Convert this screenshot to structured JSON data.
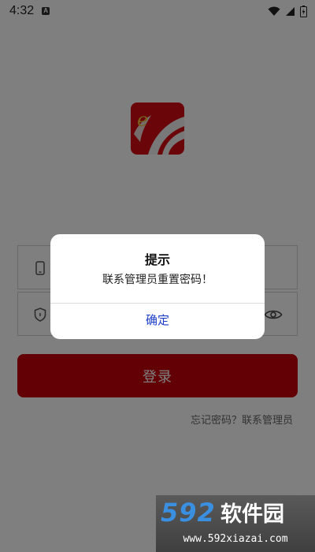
{
  "status_bar": {
    "time": "4:32",
    "notification_icon": "a-notification-icon",
    "icons": [
      "wifi-icon",
      "signal-icon",
      "battery-icon"
    ]
  },
  "app": {
    "logo_icon": "app-logo-e-icon",
    "brand_color": "#c4000a"
  },
  "form": {
    "username_icon": "phone-icon",
    "password_icon": "shield-icon",
    "visibility_icon": "eye-icon",
    "login_label": "登录",
    "forgot_text": "忘记密码？联系管理员"
  },
  "dialog": {
    "title": "提示",
    "message": "联系管理员重置密码！",
    "confirm_label": "确定",
    "accent_color": "#1a3cc7"
  },
  "watermark": {
    "title": "592软件园",
    "url": "www.592xiazai.com"
  }
}
